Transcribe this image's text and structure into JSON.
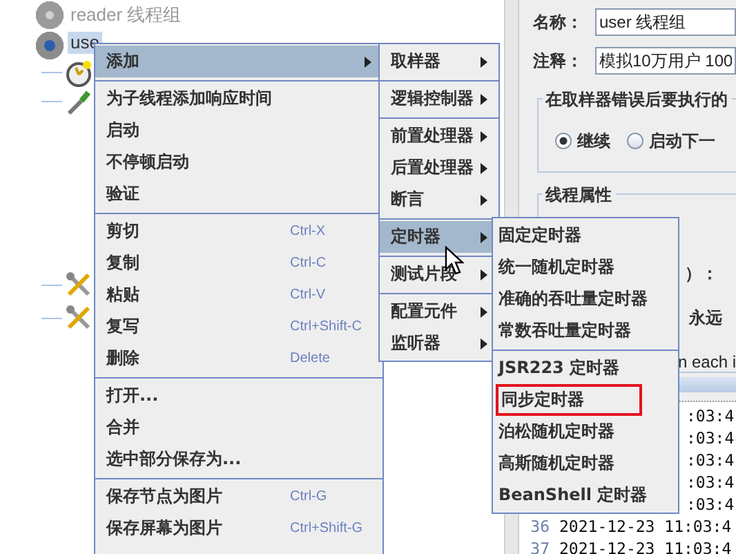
{
  "tree": [
    {
      "label": "reader 线程组",
      "kind": "thread-group",
      "disabled": true,
      "selected": false
    },
    {
      "label": "use",
      "kind": "thread-group",
      "disabled": false,
      "selected": true,
      "children": [
        {
          "kind": "timer"
        },
        {
          "kind": "sampler"
        },
        {
          "kind": "config"
        },
        {
          "kind": "config"
        }
      ]
    }
  ],
  "context_menu": {
    "sections": [
      [
        {
          "label": "添加",
          "submenu": true,
          "selected": true
        }
      ],
      [
        {
          "label": "为子线程添加响应时间",
          "submenu": false,
          "selected": false
        },
        {
          "label": "启动",
          "submenu": false,
          "selected": false
        },
        {
          "label": "不停顿启动",
          "submenu": false,
          "selected": false
        },
        {
          "label": "验证",
          "submenu": false,
          "selected": false
        }
      ],
      [
        {
          "label": "剪切",
          "shortcut": "Ctrl-X",
          "submenu": false,
          "selected": false
        },
        {
          "label": "复制",
          "shortcut": "Ctrl-C",
          "submenu": false,
          "selected": false
        },
        {
          "label": "粘贴",
          "shortcut": "Ctrl-V",
          "submenu": false,
          "selected": false
        },
        {
          "label": "复写",
          "shortcut": "Ctrl+Shift-C",
          "submenu": false,
          "selected": false
        },
        {
          "label": "删除",
          "shortcut": "Delete",
          "submenu": false,
          "selected": false
        }
      ],
      [
        {
          "label": "打开...",
          "submenu": false,
          "selected": false
        },
        {
          "label": "合并",
          "submenu": false,
          "selected": false
        },
        {
          "label": "选中部分保存为...",
          "submenu": false,
          "selected": false
        }
      ],
      [
        {
          "label": "保存节点为图片",
          "shortcut": "Ctrl-G",
          "submenu": false,
          "selected": false
        },
        {
          "label": "保存屏幕为图片",
          "shortcut": "Ctrl+Shift-G",
          "submenu": false,
          "selected": false
        }
      ]
    ]
  },
  "add_submenu": {
    "sections": [
      [
        {
          "label": "取样器",
          "submenu": true,
          "selected": false
        }
      ],
      [
        {
          "label": "逻辑控制器",
          "submenu": true,
          "selected": false
        }
      ],
      [
        {
          "label": "前置处理器",
          "submenu": true,
          "selected": false
        },
        {
          "label": "后置处理器",
          "submenu": true,
          "selected": false
        },
        {
          "label": "断言",
          "submenu": true,
          "selected": false
        }
      ],
      [
        {
          "label": "定时器",
          "submenu": true,
          "selected": true
        }
      ],
      [
        {
          "label": "测试片段",
          "submenu": true,
          "selected": false
        }
      ],
      [
        {
          "label": "配置元件",
          "submenu": true,
          "selected": false
        },
        {
          "label": "监听器",
          "submenu": true,
          "selected": false
        }
      ]
    ]
  },
  "timer_submenu": {
    "sections": [
      [
        {
          "label": "固定定时器",
          "outlined": false
        },
        {
          "label": "统一随机定时器",
          "outlined": false
        },
        {
          "label": "准确的吞吐量定时器",
          "outlined": false
        },
        {
          "label": "常数吞吐量定时器",
          "outlined": false
        }
      ],
      [
        {
          "label": "JSR223 定时器",
          "outlined": false
        },
        {
          "label": "同步定时器",
          "outlined": true
        },
        {
          "label": "泊松随机定时器",
          "outlined": false
        },
        {
          "label": "高斯随机定时器",
          "outlined": false
        },
        {
          "label": "BeanShell 定时器",
          "outlined": false
        }
      ]
    ]
  },
  "panel": {
    "name_label": "名称：",
    "name_value": "user 线程组",
    "comment_label": "注释：",
    "comment_value": "模拟10万用户 100",
    "error_group": {
      "title": "在取样器错误后要执行的",
      "radios": [
        {
          "label": "继续",
          "selected": true
        },
        {
          "label": "启动下一",
          "selected": false
        }
      ]
    },
    "thread_group": {
      "title": "线程属性",
      "texts": [
        "）：",
        "永远",
        "n each i"
      ]
    },
    "log": [
      {
        "text": ":03:4"
      },
      {
        "text": ":03:4"
      },
      {
        "text": ":03:4"
      },
      {
        "text": ":03:4"
      },
      {
        "text": ":03:4"
      },
      {
        "number": "36",
        "text": "2021-12-23 11:03:4"
      },
      {
        "number": "37",
        "text": "2021-12-23 11:03:4"
      }
    ]
  }
}
